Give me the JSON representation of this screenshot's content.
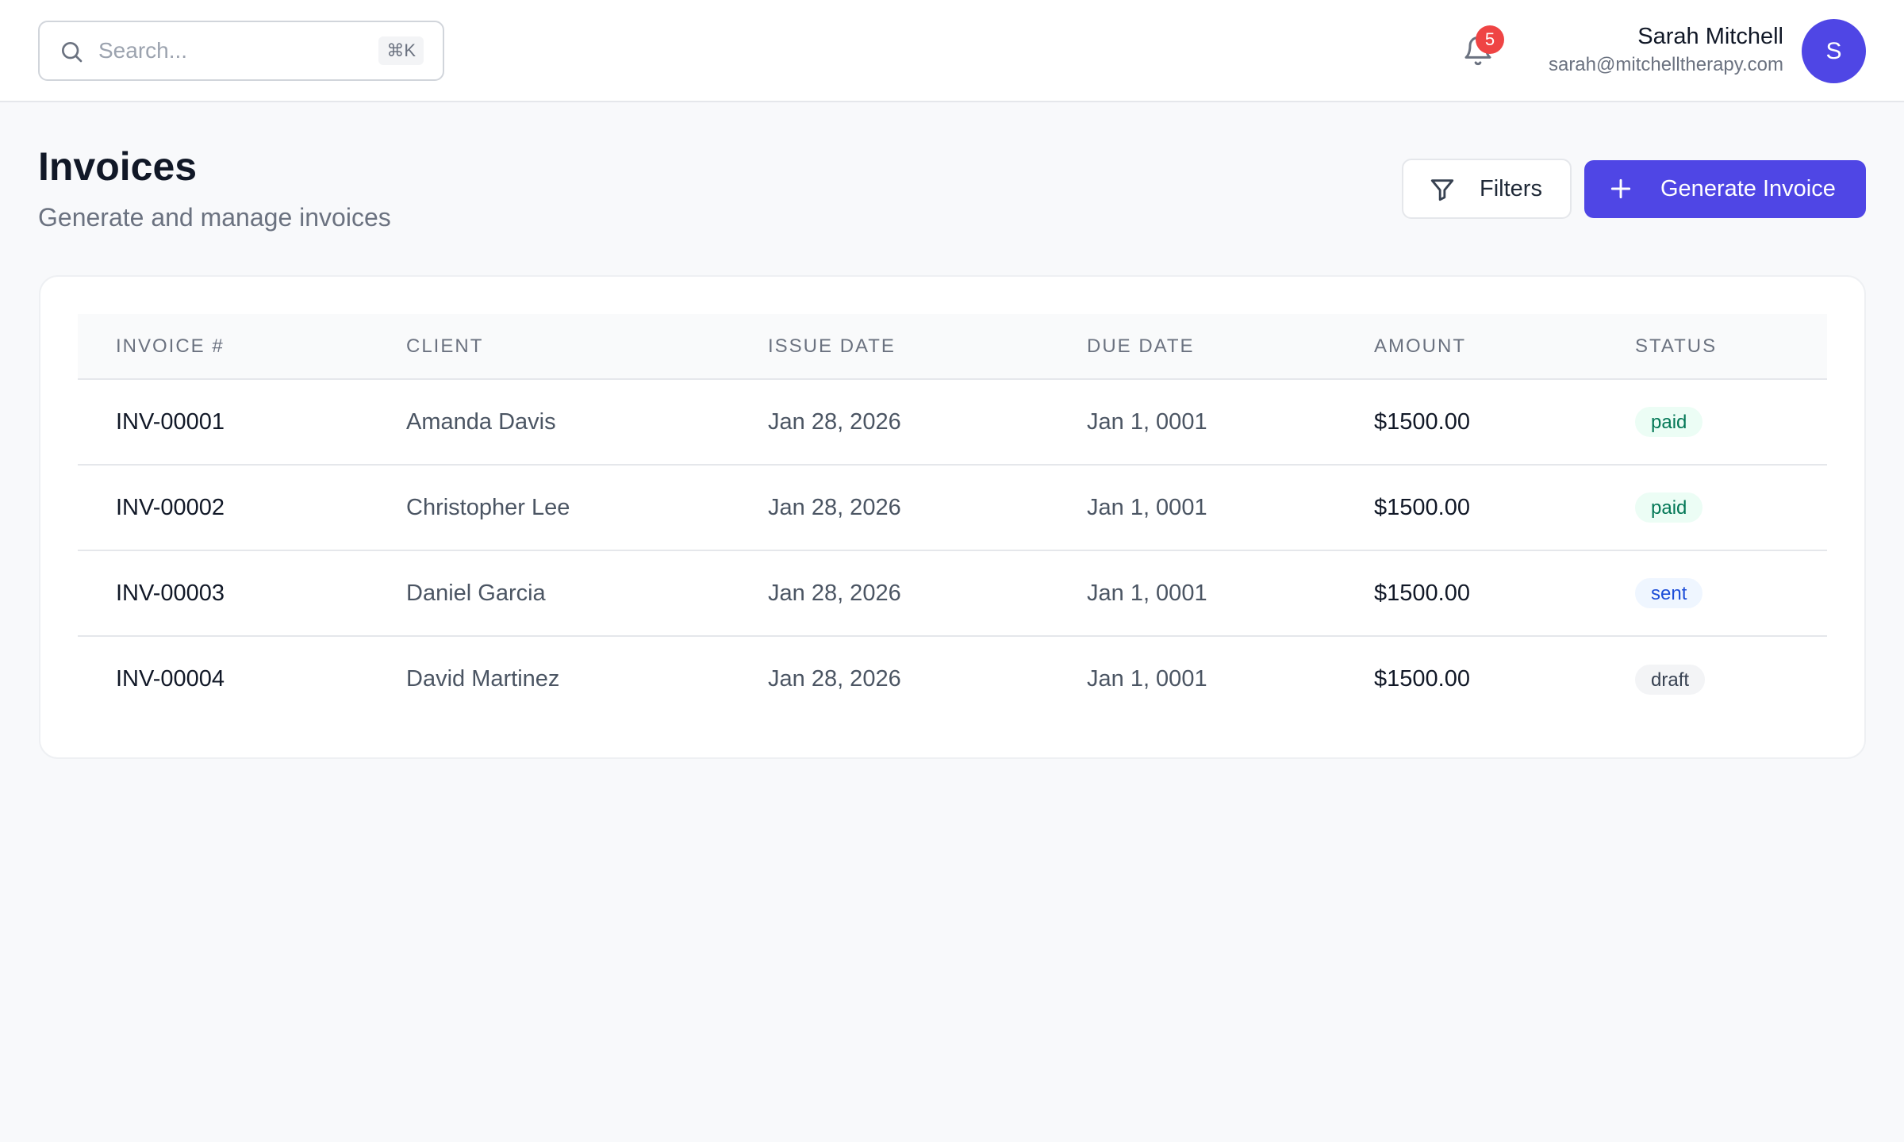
{
  "search": {
    "placeholder": "Search...",
    "shortcut": "⌘K"
  },
  "notifications": {
    "count": "5"
  },
  "user": {
    "name": "Sarah Mitchell",
    "email": "sarah@mitchelltherapy.com",
    "initial": "S"
  },
  "header": {
    "title": "Invoices",
    "subtitle": "Generate and manage invoices",
    "filters_label": "Filters",
    "generate_label": "Generate Invoice"
  },
  "table": {
    "columns": [
      "INVOICE #",
      "CLIENT",
      "ISSUE DATE",
      "DUE DATE",
      "AMOUNT",
      "STATUS"
    ],
    "rows": [
      {
        "invoice": "INV-00001",
        "client": "Amanda Davis",
        "issue_date": "Jan 28, 2026",
        "due_date": "Jan 1, 0001",
        "amount": "$1500.00",
        "status": "paid"
      },
      {
        "invoice": "INV-00002",
        "client": "Christopher Lee",
        "issue_date": "Jan 28, 2026",
        "due_date": "Jan 1, 0001",
        "amount": "$1500.00",
        "status": "paid"
      },
      {
        "invoice": "INV-00003",
        "client": "Daniel Garcia",
        "issue_date": "Jan 28, 2026",
        "due_date": "Jan 1, 0001",
        "amount": "$1500.00",
        "status": "sent"
      },
      {
        "invoice": "INV-00004",
        "client": "David Martinez",
        "issue_date": "Jan 28, 2026",
        "due_date": "Jan 1, 0001",
        "amount": "$1500.00",
        "status": "draft"
      }
    ]
  },
  "colors": {
    "accent": "#4f46e5",
    "notification_badge": "#ef4444",
    "status_paid_bg": "#ecfdf5",
    "status_paid_text": "#047857",
    "status_sent_bg": "#eff6ff",
    "status_sent_text": "#1d4ed8",
    "status_draft_bg": "#f3f4f6",
    "status_draft_text": "#374151"
  },
  "icons": {
    "search": "search-icon",
    "notifications": "bell-icon",
    "filters": "filter-icon",
    "generate": "plus-icon"
  }
}
